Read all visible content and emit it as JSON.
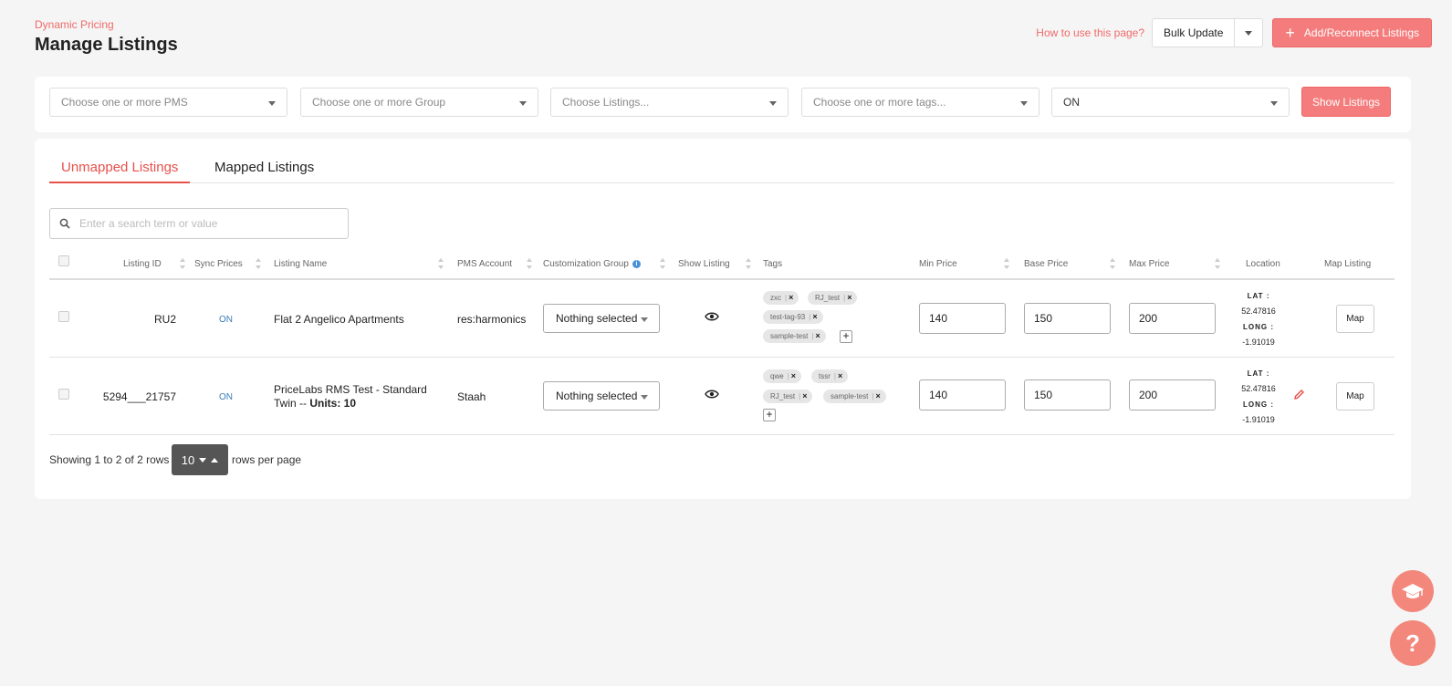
{
  "header": {
    "breadcrumb": "Dynamic Pricing",
    "title": "Manage Listings",
    "how_to": "How to use this page?",
    "bulk_update": "Bulk Update",
    "add_reconnect": "Add/Reconnect Listings"
  },
  "filters": {
    "pms_placeholder": "Choose one or more PMS",
    "group_placeholder": "Choose one or more Group",
    "listings_placeholder": "Choose Listings...",
    "tags_placeholder": "Choose one or more tags...",
    "status_value": "ON",
    "show_button": "Show Listings"
  },
  "tabs": {
    "unmapped": "Unmapped Listings",
    "mapped": "Mapped Listings"
  },
  "search": {
    "placeholder": "Enter a search term or value"
  },
  "columns": {
    "listing_id": "Listing ID",
    "sync_prices": "Sync Prices",
    "listing_name": "Listing Name",
    "pms_account": "PMS Account",
    "customization_group": "Customization Group",
    "show_listing": "Show Listing",
    "tags": "Tags",
    "min_price": "Min Price",
    "base_price": "Base Price",
    "max_price": "Max Price",
    "location": "Location",
    "map_listing": "Map Listing"
  },
  "rows": [
    {
      "id": "RU2",
      "sync": "ON",
      "name": "Flat 2 Angelico Apartments",
      "name_units": "",
      "pms": "res:harmonics",
      "group": "Nothing selected",
      "tags": [
        "zxc",
        "RJ_test",
        "test-tag-93",
        "sample-test"
      ],
      "min": "140",
      "base": "150",
      "max": "200",
      "lat_label": "LAT :",
      "lat": "52.47816",
      "long_label": "LONG :",
      "long": "-1.91019",
      "map": "Map"
    },
    {
      "id": "5294___21757",
      "sync": "ON",
      "name": "PriceLabs RMS Test - Standard Twin --",
      "name_units": "Units: 10",
      "pms": "Staah",
      "group": "Nothing selected",
      "tags": [
        "qwe",
        "tssr",
        "RJ_test",
        "sample-test"
      ],
      "min": "140",
      "base": "150",
      "max": "200",
      "lat_label": "LAT :",
      "lat": "52.47816",
      "long_label": "LONG :",
      "long": "-1.91019",
      "map": "Map"
    }
  ],
  "footer": {
    "showing": "Showing 1 to 2 of 2 rows",
    "page_size": "10",
    "rows_per_page": "rows per page"
  },
  "colors": {
    "accent": "#f47c7c",
    "link": "#3a7ab8"
  }
}
